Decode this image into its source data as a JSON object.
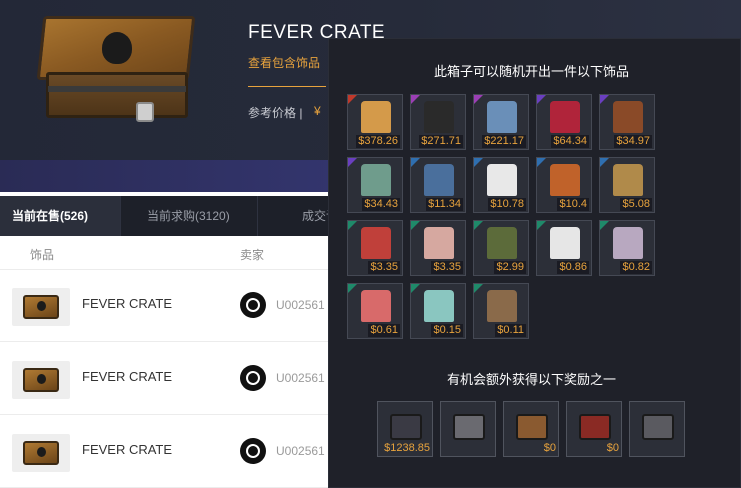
{
  "header": {
    "title": "FEVER CRATE",
    "contents_link": "查看包含饰品",
    "ref_price_label": "参考价格 |",
    "ref_price_value": "¥",
    "colors": {
      "link": "#e8a33d",
      "background": "#232837"
    }
  },
  "tabs": [
    {
      "label": "当前在售(526)",
      "active": true
    },
    {
      "label": "当前求购(3120)",
      "active": false
    },
    {
      "label": "成交记",
      "active": false
    }
  ],
  "list": {
    "columns": [
      "饰品",
      "卖家"
    ],
    "rows": [
      {
        "name": "FEVER CRATE",
        "seller": "U002561"
      },
      {
        "name": "FEVER CRATE",
        "seller": "U002561"
      },
      {
        "name": "FEVER CRATE",
        "seller": "U002561"
      }
    ]
  },
  "popup": {
    "title": "此箱子可以随机开出一件以下饰品",
    "bonus_title": "有机会额外获得以下奖励之一",
    "items": [
      {
        "icon": "plaid-skirt-icon",
        "price": "$378.26",
        "rarity": "#c0392b",
        "art": "#d49a4a"
      },
      {
        "icon": "black-top-icon",
        "price": "$271.71",
        "rarity": "#9b3fb5",
        "art": "#2a2a2a"
      },
      {
        "icon": "denim-jacket-icon",
        "price": "$221.17",
        "rarity": "#9b3fb5",
        "art": "#6a8fb8"
      },
      {
        "icon": "red-scarf-icon",
        "price": "$64.34",
        "rarity": "#6a3fc0",
        "art": "#b0243a"
      },
      {
        "icon": "leather-jacket-icon",
        "price": "$34.97",
        "rarity": "#6a3fc0",
        "art": "#8a4a28"
      },
      {
        "icon": "green-jacket-icon",
        "price": "$34.43",
        "rarity": "#6a3fc0",
        "art": "#6f9c8c"
      },
      {
        "icon": "jeans-icon",
        "price": "$11.34",
        "rarity": "#2f6fb0",
        "art": "#4a6f9c"
      },
      {
        "icon": "glasses-icon",
        "price": "$10.78",
        "rarity": "#2f6fb0",
        "art": "#e8e8e8"
      },
      {
        "icon": "orange-pants-icon",
        "price": "$10.4",
        "rarity": "#2f6fb0",
        "art": "#c0622a"
      },
      {
        "icon": "boots-icon",
        "price": "$5.08",
        "rarity": "#2f6fb0",
        "art": "#b08a4a"
      },
      {
        "icon": "red-pants-icon",
        "price": "$3.35",
        "rarity": "#1f8a6a",
        "art": "#c0403a"
      },
      {
        "icon": "sneakers-icon",
        "price": "$3.35",
        "rarity": "#1f8a6a",
        "art": "#d6a8a0"
      },
      {
        "icon": "gloves-icon",
        "price": "$2.99",
        "rarity": "#1f8a6a",
        "art": "#5c6b3a"
      },
      {
        "icon": "white-shirt-icon",
        "price": "$0.86",
        "rarity": "#1f8a6a",
        "art": "#e6e6e6"
      },
      {
        "icon": "plaid-shirt-icon",
        "price": "$0.82",
        "rarity": "#1f8a6a",
        "art": "#b8a8c0"
      },
      {
        "icon": "striped-polo-icon",
        "price": "$0.61",
        "rarity": "#1f8a6a",
        "art": "#d86a6a"
      },
      {
        "icon": "teal-tshirt-icon",
        "price": "$0.15",
        "rarity": "#1f8a6a",
        "art": "#8ac6c0"
      },
      {
        "icon": "loafers-icon",
        "price": "$0.11",
        "rarity": "#1f8a6a",
        "art": "#8a6a4a"
      }
    ],
    "bonus": [
      {
        "icon": "dark-crate-icon",
        "price": "$1238.85",
        "art": "#3a3a44"
      },
      {
        "icon": "grey-crate-icon",
        "price": "",
        "art": "#6a6a70"
      },
      {
        "icon": "brown-crate-icon",
        "price": "$0",
        "art": "#8a5a30"
      },
      {
        "icon": "red-crate-icon",
        "price": "$0",
        "art": "#8a2a24"
      },
      {
        "icon": "silver-crate-icon",
        "price": "",
        "art": "#5a5a60"
      }
    ]
  }
}
